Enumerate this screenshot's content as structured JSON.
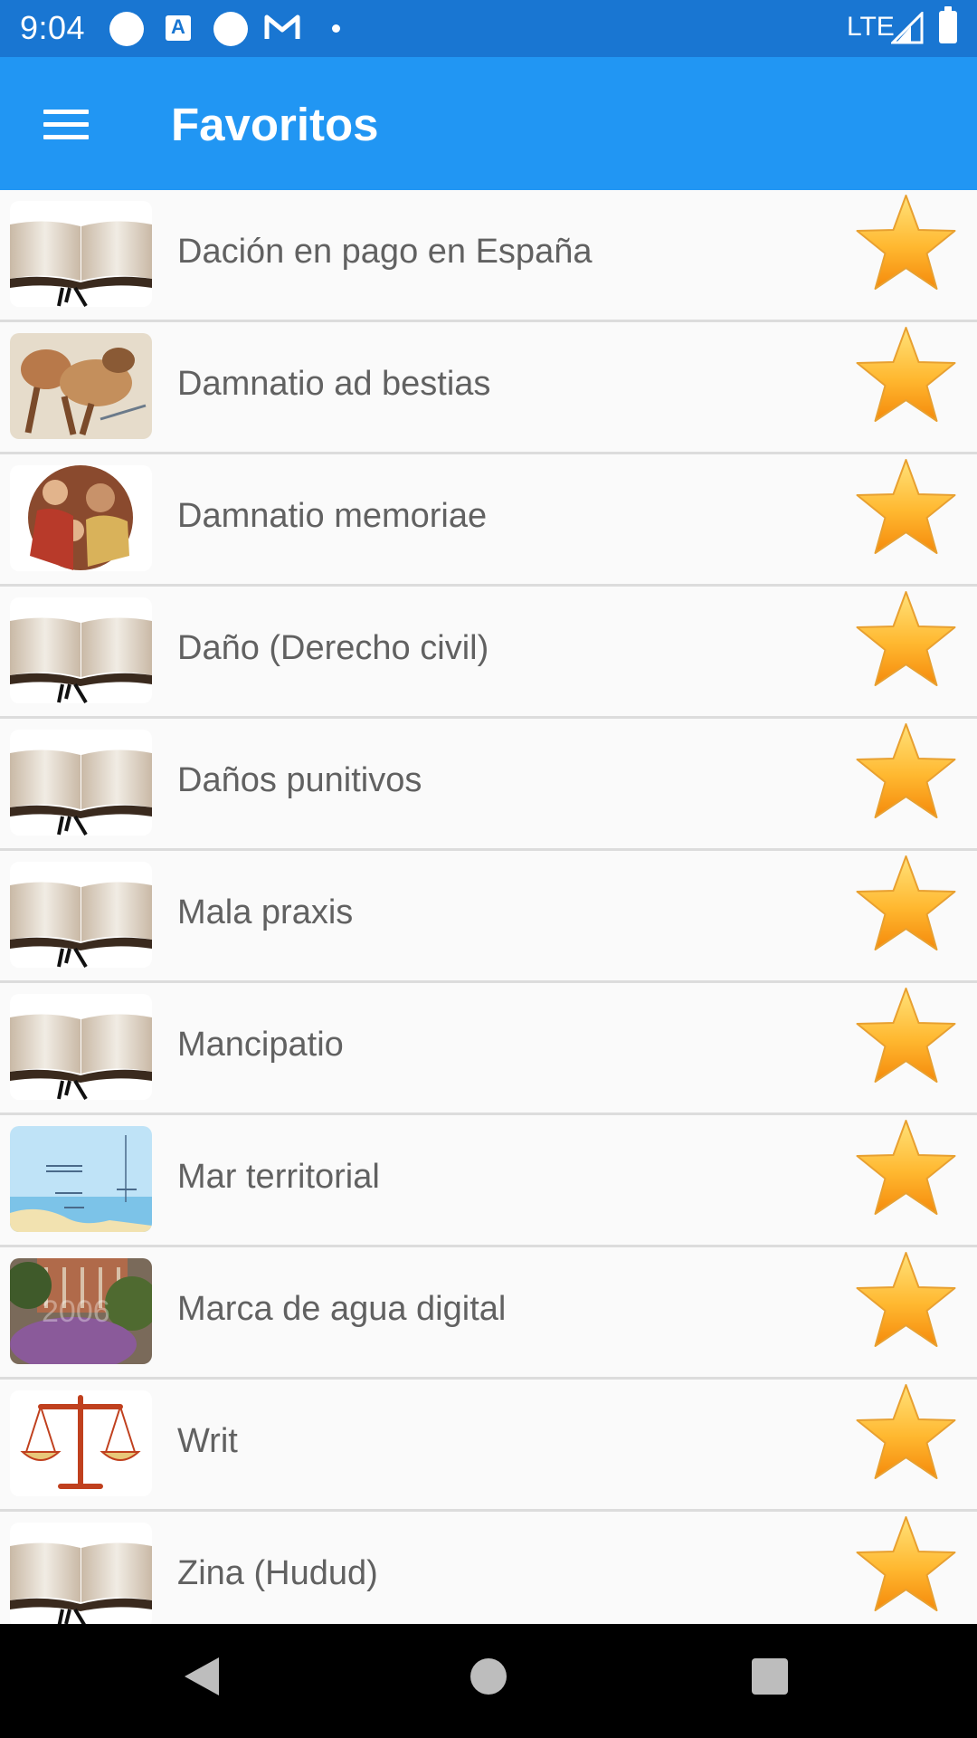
{
  "status_bar": {
    "time": "9:04",
    "network": "LTE",
    "icons": [
      "circle-icon",
      "a-icon",
      "circle-icon",
      "gmail-icon",
      "dot-icon",
      "signal-icon",
      "battery-icon"
    ]
  },
  "app_bar": {
    "title": "Favoritos",
    "menu_icon": "hamburger-icon",
    "color": "#2196f3",
    "status_color": "#1976d2"
  },
  "favorites": [
    {
      "label": "Dación en pago en España",
      "thumbnail": "open-book-image"
    },
    {
      "label": "Damnatio ad bestias",
      "thumbnail": "mosaic-animal-image"
    },
    {
      "label": "Damnatio memoriae",
      "thumbnail": "family-portrait-image"
    },
    {
      "label": "Daño (Derecho civil)",
      "thumbnail": "open-book-image"
    },
    {
      "label": "Daños punitivos",
      "thumbnail": "open-book-image"
    },
    {
      "label": "Mala praxis",
      "thumbnail": "open-book-image"
    },
    {
      "label": "Mancipatio",
      "thumbnail": "open-book-image"
    },
    {
      "label": "Mar territorial",
      "thumbnail": "sea-diagram-image"
    },
    {
      "label": "Marca de agua digital",
      "thumbnail": "watermark-photo-image"
    },
    {
      "label": "Writ",
      "thumbnail": "scales-of-justice-image"
    },
    {
      "label": "Zina (Hudud)",
      "thumbnail": "open-book-image"
    }
  ],
  "favorite_icon": "star-icon",
  "nav_bar": {
    "back": "back-icon",
    "home": "home-icon",
    "recents": "recents-icon"
  }
}
